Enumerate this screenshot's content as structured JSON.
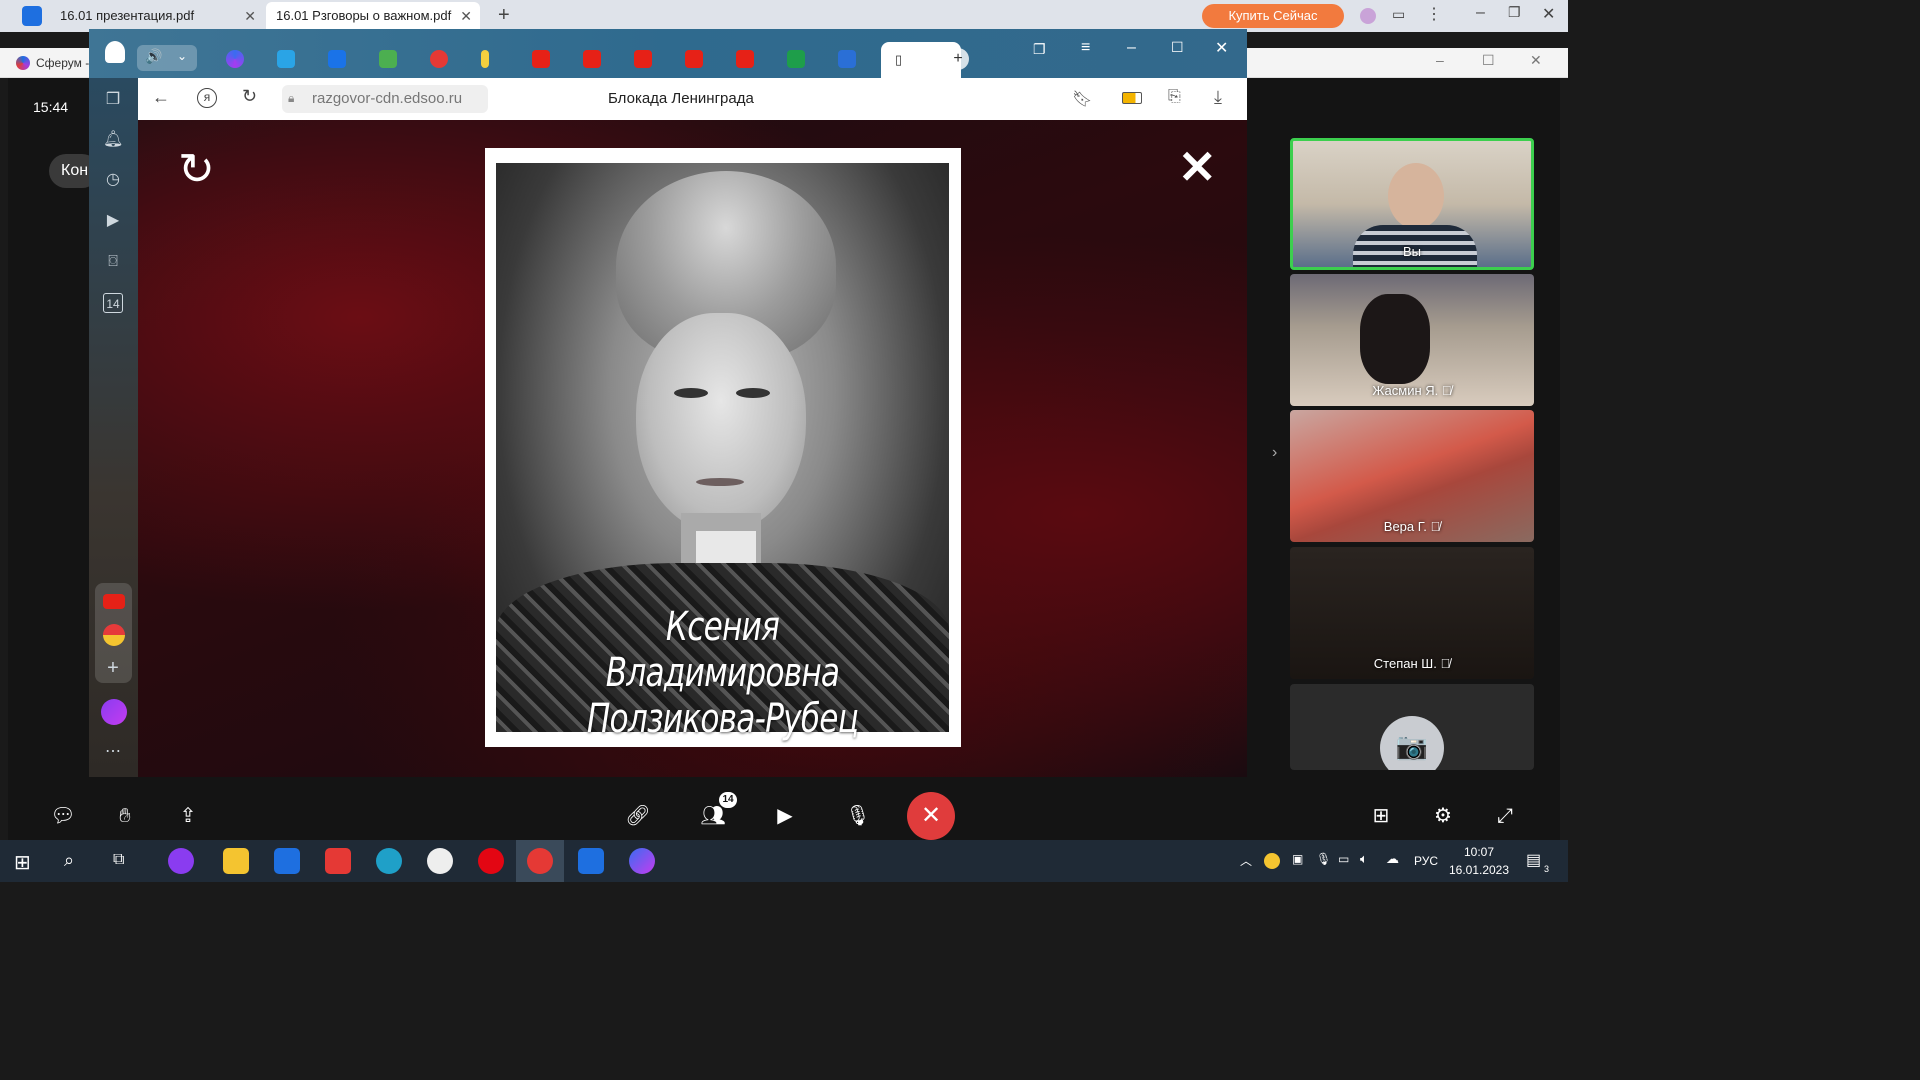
{
  "pdf_app": {
    "tabs": [
      {
        "label": "16.01 презентация.pdf",
        "close": "✕"
      },
      {
        "label": "16.01 Рзговоры о важном.pdf",
        "close": "✕"
      }
    ],
    "new_tab": "+",
    "buy_button": "Купить Сейчас"
  },
  "sferum": {
    "tab_label": "Сферум -",
    "time": "15:44",
    "left_chip": "Кон"
  },
  "browser": {
    "url": "razgovor-cdn.edsoo.ru",
    "page_title": "Блокада Ленинграда",
    "side_badge": "14"
  },
  "slide": {
    "caption_line1": "Ксения Владимировна",
    "caption_line2": "Ползикова-Рубец"
  },
  "participants": [
    {
      "name": "Вы"
    },
    {
      "name": "Жасмин Я."
    },
    {
      "name": "Вера Г."
    },
    {
      "name": "Степан Ш."
    },
    {
      "name": ""
    }
  ],
  "call": {
    "participants_badge": "14"
  },
  "taskbar": {
    "time": "10:07",
    "date": "16.01.2023",
    "lang": "РУС",
    "notif_count": "3"
  },
  "colors": {
    "accent_orange": "#f27a3e",
    "end_call_red": "#e03c3c",
    "active_tile_border": "#3ccf4e"
  }
}
